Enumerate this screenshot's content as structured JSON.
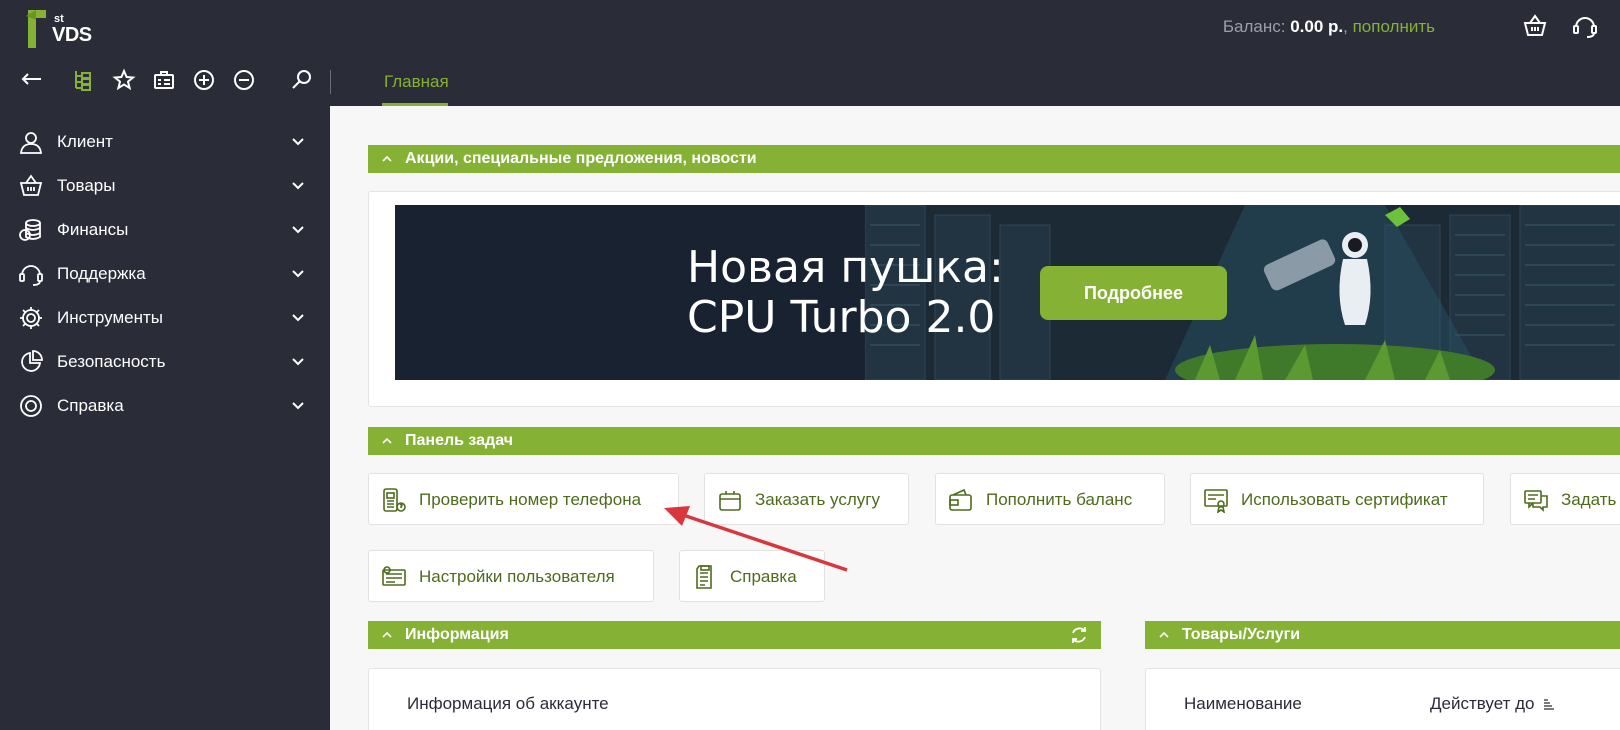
{
  "header": {
    "logo_text": "VDS",
    "logo_sup": "st",
    "balance_label": "Баланс: ",
    "balance_amount": "0.00 р.",
    "balance_sep": ", ",
    "topup_label": "пополнить",
    "active_tab": "Главная"
  },
  "sidebar": {
    "items": [
      {
        "label": "Клиент",
        "icon": "client-icon"
      },
      {
        "label": "Товары",
        "icon": "basket-icon"
      },
      {
        "label": "Финансы",
        "icon": "finance-icon"
      },
      {
        "label": "Поддержка",
        "icon": "support-icon"
      },
      {
        "label": "Инструменты",
        "icon": "gear-icon"
      },
      {
        "label": "Безопасность",
        "icon": "pie-icon"
      },
      {
        "label": "Справка",
        "icon": "lifebuoy-icon"
      }
    ]
  },
  "sections": {
    "news": "Акции, специальные предложения, новости",
    "tasks": "Панель задач",
    "info": "Информация",
    "products": "Товары/Услуги"
  },
  "banner": {
    "title_line1": "Новая пушка:",
    "title_line2": "CPU Turbo 2.0",
    "button": "Подробнее"
  },
  "tasks": [
    {
      "label": "Проверить номер телефона",
      "icon": "phone-check-icon"
    },
    {
      "label": "Заказать услугу",
      "icon": "order-bag-icon"
    },
    {
      "label": "Пополнить баланс",
      "icon": "wallet-icon"
    },
    {
      "label": "Использовать сертификат",
      "icon": "certificate-icon"
    },
    {
      "label": "Задать",
      "icon": "chat-icon"
    },
    {
      "label": "Настройки пользователя",
      "icon": "user-settings-icon"
    },
    {
      "label": "Справка",
      "icon": "doc-help-icon"
    }
  ],
  "info": {
    "account_info": "Информация об аккаунте"
  },
  "products": {
    "col_name": "Наименование",
    "col_valid": "Действует до"
  },
  "colors": {
    "accent": "#85b234",
    "dark": "#2a2c38",
    "arrow": "#d9363e"
  }
}
